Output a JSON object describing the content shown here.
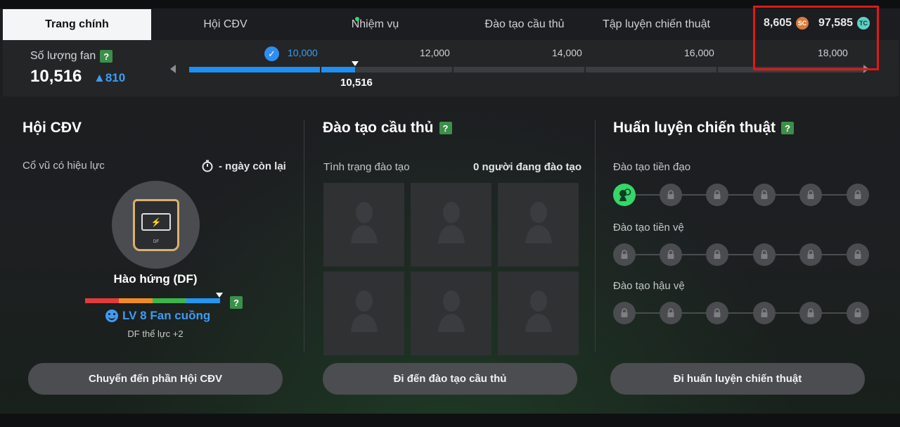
{
  "tabs": [
    {
      "label": "Trang chính",
      "active": true
    },
    {
      "label": "Hội CĐV",
      "active": false
    },
    {
      "label": "Nhiệm vụ",
      "active": false,
      "notification": true
    },
    {
      "label": "Đào tạo cầu thủ",
      "active": false
    },
    {
      "label": "Tập luyện chiến thuật",
      "active": false
    }
  ],
  "currency": {
    "sc_amount": "8,605",
    "sc_icon_text": "SC",
    "tc_amount": "97,585",
    "tc_icon_text": "TC"
  },
  "fans": {
    "label": "Số lượng fan",
    "help": "?",
    "count": "10,516",
    "delta": "▲810",
    "current_marker": "10,516",
    "progress_fraction_of_next_milestone": 0.26,
    "milestones": [
      "10,000",
      "12,000",
      "14,000",
      "16,000",
      "18,000"
    ]
  },
  "fan_club": {
    "title": "Hội CĐV",
    "cheer_label": "Cổ vũ có hiệu lực",
    "remaining": "- ngày còn lại",
    "badge_name": "Hào hứng (DF)",
    "badge_tag": "DF",
    "level": "LV 8 Fan cuồng",
    "bonus": "DF thể lực +2",
    "mood_colors": [
      "#e23b3b",
      "#f08a24",
      "#3cb54a",
      "#2196f3"
    ],
    "button": "Chuyển đến phần Hội CĐV"
  },
  "player_training": {
    "title": "Đào tạo cầu thủ",
    "help": "?",
    "status_label": "Tình trạng đào tạo",
    "status_value": "0 người đang đào tạo",
    "button": "Đi đến đào tạo cầu thủ"
  },
  "tactics": {
    "title": "Huấn luyện chiến thuật",
    "help": "?",
    "rows": [
      {
        "label": "Đào tạo tiền đạo",
        "unlocked": 1
      },
      {
        "label": "Đào tạo tiền vệ",
        "unlocked": 0
      },
      {
        "label": "Đào tạo hậu vệ",
        "unlocked": 0
      }
    ],
    "button": "Đi huấn luyện chiến thuật"
  },
  "colors": {
    "accent_blue": "#1f8ff2",
    "accent_green": "#36d66b",
    "highlight_red": "#e01818"
  }
}
